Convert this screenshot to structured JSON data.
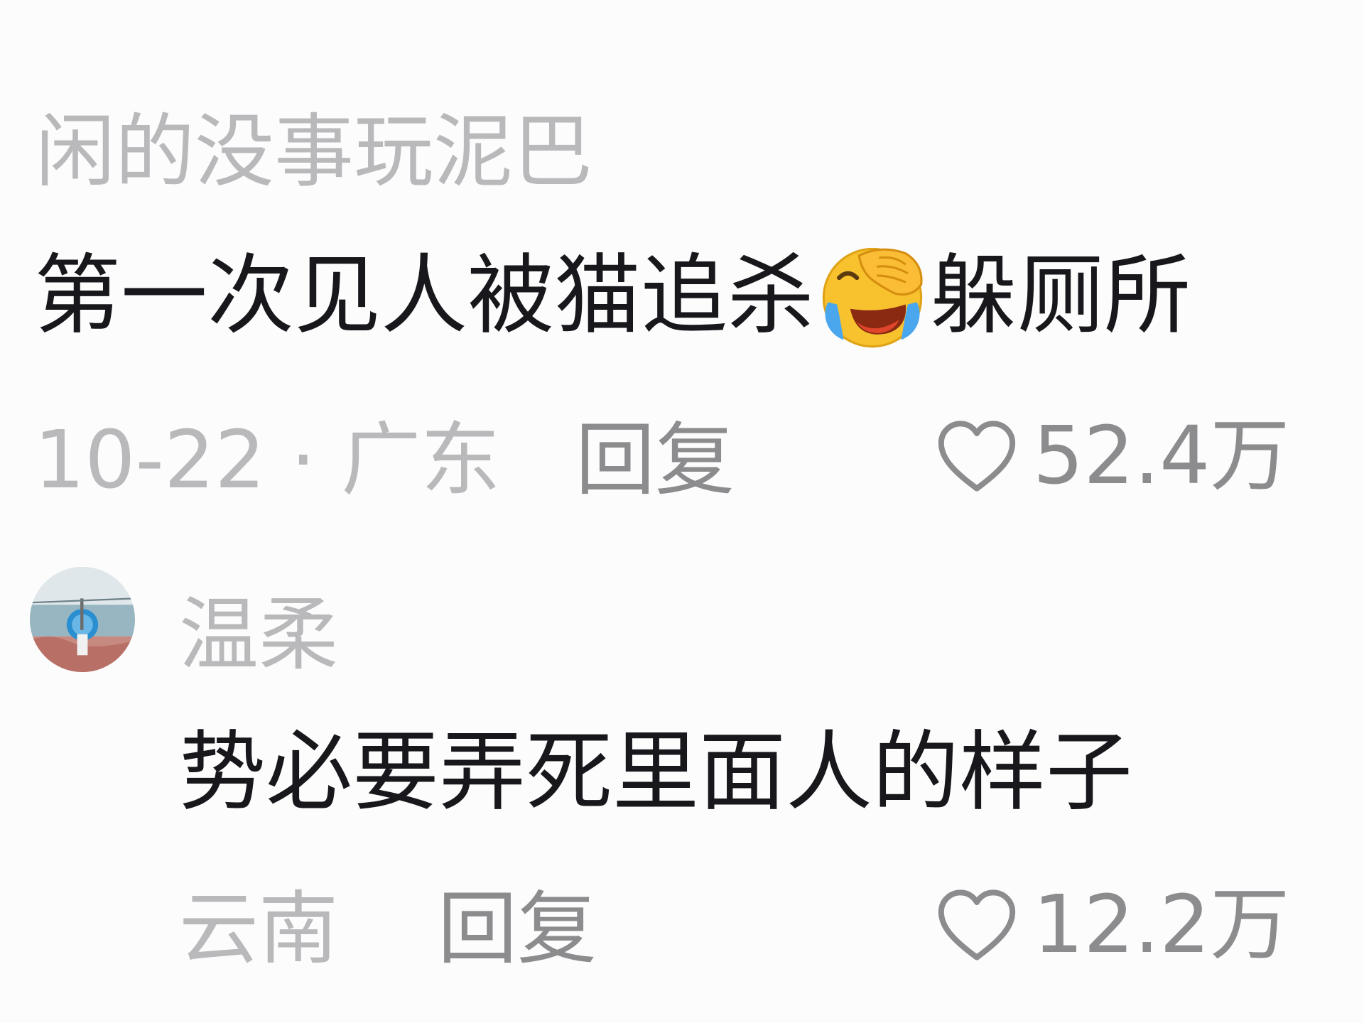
{
  "comments": [
    {
      "username": "闲的没事玩泥巴",
      "text_before": "第一次见人被猫追杀",
      "emoji": "face-palm-laughing-crying",
      "text_after": "躲厕所",
      "meta": "10-22 · 广东",
      "reply_label": "回复",
      "like_icon": "heart-outline-icon",
      "likes": "52.4万"
    },
    {
      "username": "温柔",
      "avatar": "avatar-photo",
      "text": "势必要弄死里面人的样子",
      "meta": "云南",
      "reply_label": "回复",
      "like_icon": "heart-outline-icon",
      "likes": "12.2万"
    }
  ]
}
